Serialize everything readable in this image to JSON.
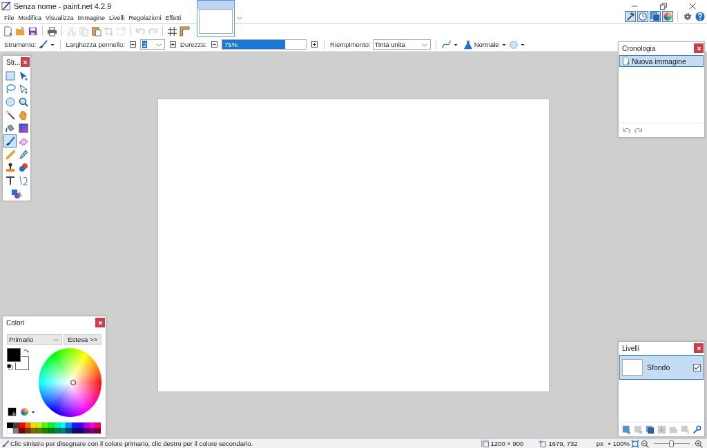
{
  "window": {
    "title": "Senza nome - paint.net 4.2.9"
  },
  "menu": [
    {
      "label": "File"
    },
    {
      "label": "Modifica"
    },
    {
      "label": "Visualizza"
    },
    {
      "label": "Immagine"
    },
    {
      "label": "Livelli"
    },
    {
      "label": "Regolazioni"
    },
    {
      "label": "Effetti"
    }
  ],
  "image_tabs": [
    {
      "selected": true
    }
  ],
  "panel_toggles": [
    {
      "kind": "tools",
      "selected": true
    },
    {
      "kind": "history",
      "selected": true
    },
    {
      "kind": "layers",
      "selected": true
    },
    {
      "kind": "colors",
      "selected": true
    }
  ],
  "toolbar": [
    [
      {
        "kind": "new",
        "disabled": false
      },
      {
        "kind": "open",
        "disabled": false
      },
      {
        "kind": "save",
        "disabled": false
      }
    ],
    [
      {
        "kind": "print",
        "disabled": false
      }
    ],
    [
      {
        "kind": "cut",
        "disabled": true
      },
      {
        "kind": "copy",
        "disabled": true
      },
      {
        "kind": "paste",
        "disabled": false
      },
      {
        "kind": "crop",
        "disabled": true
      },
      {
        "kind": "deselect",
        "disabled": true
      }
    ],
    [
      {
        "kind": "undo",
        "disabled": true
      },
      {
        "kind": "redo",
        "disabled": true
      }
    ],
    [
      {
        "kind": "grid",
        "disabled": false
      },
      {
        "kind": "ruler",
        "disabled": false
      }
    ]
  ],
  "tool_options": {
    "tool_label": "Strumento:",
    "width_label": "Larghezza pennello:",
    "width_value": "2",
    "width_value_highlighted": true,
    "hardness_label": "Durezza:",
    "hardness": {
      "level": 0.75,
      "reading": "75%"
    },
    "fill_label": "Riempimento:",
    "fill_value": "Tinta unita",
    "blend_mode": "Normale"
  },
  "tools_panel": {
    "title": "Str...",
    "tools": [
      {
        "kind": "rect-select",
        "selected": false
      },
      {
        "kind": "move-pixels",
        "selected": false
      },
      {
        "kind": "lasso",
        "selected": false
      },
      {
        "kind": "move-selection",
        "selected": false
      },
      {
        "kind": "ellipse-select",
        "selected": false
      },
      {
        "kind": "zoom",
        "selected": false
      },
      {
        "kind": "magic-wand",
        "selected": false
      },
      {
        "kind": "pan",
        "selected": false
      },
      {
        "kind": "bucket",
        "selected": false
      },
      {
        "kind": "gradient",
        "selected": false
      },
      {
        "kind": "brush",
        "selected": true
      },
      {
        "kind": "eraser",
        "selected": false
      },
      {
        "kind": "pencil",
        "selected": false
      },
      {
        "kind": "picker",
        "selected": false
      },
      {
        "kind": "stamp",
        "selected": false
      },
      {
        "kind": "recolor",
        "selected": false
      },
      {
        "kind": "text",
        "selected": false
      },
      {
        "kind": "line",
        "selected": false
      },
      {
        "kind": "shapes",
        "selected": false
      }
    ]
  },
  "history_panel": {
    "title": "Cronologia",
    "items": [
      {
        "label": "Nuova immagine",
        "selected": true
      }
    ]
  },
  "colors_panel": {
    "title": "Colori",
    "target": "Primario",
    "more_button": "Estesa >>",
    "primary": {
      "color": "#000000"
    },
    "secondary": {
      "color": "#ffffff"
    },
    "palette": [
      {
        "color": "#000000"
      },
      {
        "color": "#404040"
      },
      {
        "color": "#ff0000"
      },
      {
        "color": "#ff6a00"
      },
      {
        "color": "#ffd800"
      },
      {
        "color": "#b6ff00"
      },
      {
        "color": "#4cff00"
      },
      {
        "color": "#00ff21"
      },
      {
        "color": "#00ff90"
      },
      {
        "color": "#00ffff"
      },
      {
        "color": "#0094ff"
      },
      {
        "color": "#0026ff"
      },
      {
        "color": "#4800ff"
      },
      {
        "color": "#b200ff"
      },
      {
        "color": "#ff00dc"
      },
      {
        "color": "#ff006e"
      },
      {
        "color": "#ffffff"
      },
      {
        "color": "#808080"
      },
      {
        "color": "#7f0000"
      },
      {
        "color": "#7f3300"
      },
      {
        "color": "#7f6a00"
      },
      {
        "color": "#5b7f00"
      },
      {
        "color": "#267f00"
      },
      {
        "color": "#007f0e"
      },
      {
        "color": "#007f46"
      },
      {
        "color": "#007f7f"
      },
      {
        "color": "#004a7f"
      },
      {
        "color": "#00137f"
      },
      {
        "color": "#21007f"
      },
      {
        "color": "#57007f"
      },
      {
        "color": "#7f006e"
      },
      {
        "color": "#7f0037"
      }
    ]
  },
  "layers_panel": {
    "title": "Livelli",
    "layers": [
      {
        "name": "Sfondo",
        "selected": true,
        "visible": true
      }
    ]
  },
  "status_bar": {
    "message": "Clic sinistro per disegnare con il colore primario, clic destro per il colore secondario.",
    "image_size": "1200 × 900",
    "cursor_position": "1679, 732",
    "units": "px",
    "zoom": "100%",
    "zoom_slider": {
      "level": 0.5
    }
  }
}
